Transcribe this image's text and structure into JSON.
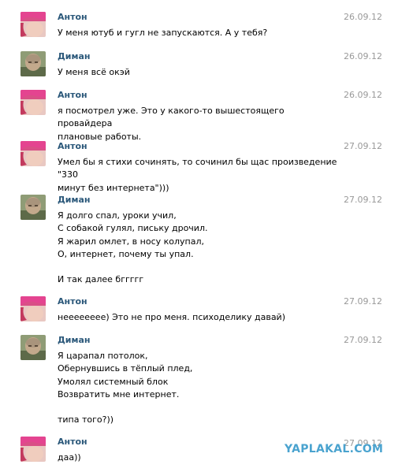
{
  "messages": [
    {
      "author": "Антон",
      "avatar": "anton-avatar",
      "date": "26.09.12",
      "text": "У меня ютуб и гугл не запускаются. А у тебя?"
    },
    {
      "author": "Диман",
      "avatar": "diman-avatar",
      "date": "26.09.12",
      "text": "У меня всё окэй"
    },
    {
      "author": "Антон",
      "avatar": "anton-avatar",
      "date": "26.09.12",
      "text": "я посмотрел уже. Это у какого-то вышестоящего провайдера\nплановые работы."
    },
    {
      "author": "Антон",
      "avatar": "anton-avatar",
      "date": "27.09.12",
      "text": "Умел бы я стихи сочинять, то сочинил бы щас произведение \"330\nминут без интернета\")))"
    },
    {
      "author": "Диман",
      "avatar": "diman-avatar",
      "date": "27.09.12",
      "text": "Я долго спал, уроки учил,\nС собакой гулял, письку дрочил.\nЯ жарил омлет, в носу колупал,\nО, интернет, почему ты упал.\n\nИ так далее бггггг"
    },
    {
      "author": "Антон",
      "avatar": "anton-avatar",
      "date": "27.09.12",
      "text": "неееееееe) Это не про меня. психоделику давай)"
    },
    {
      "author": "Диман",
      "avatar": "diman-avatar",
      "date": "27.09.12",
      "text": "Я царапал потолок,\nОбернувшись в тёплый плед,\nУмолял системный блок\nВозвратить мне интернет.\n\nтипа того?))"
    },
    {
      "author": "Антон",
      "avatar": "anton-avatar",
      "date": "27.09.12",
      "text": "даа))"
    }
  ],
  "watermark": "YAPLAKAL.COM"
}
